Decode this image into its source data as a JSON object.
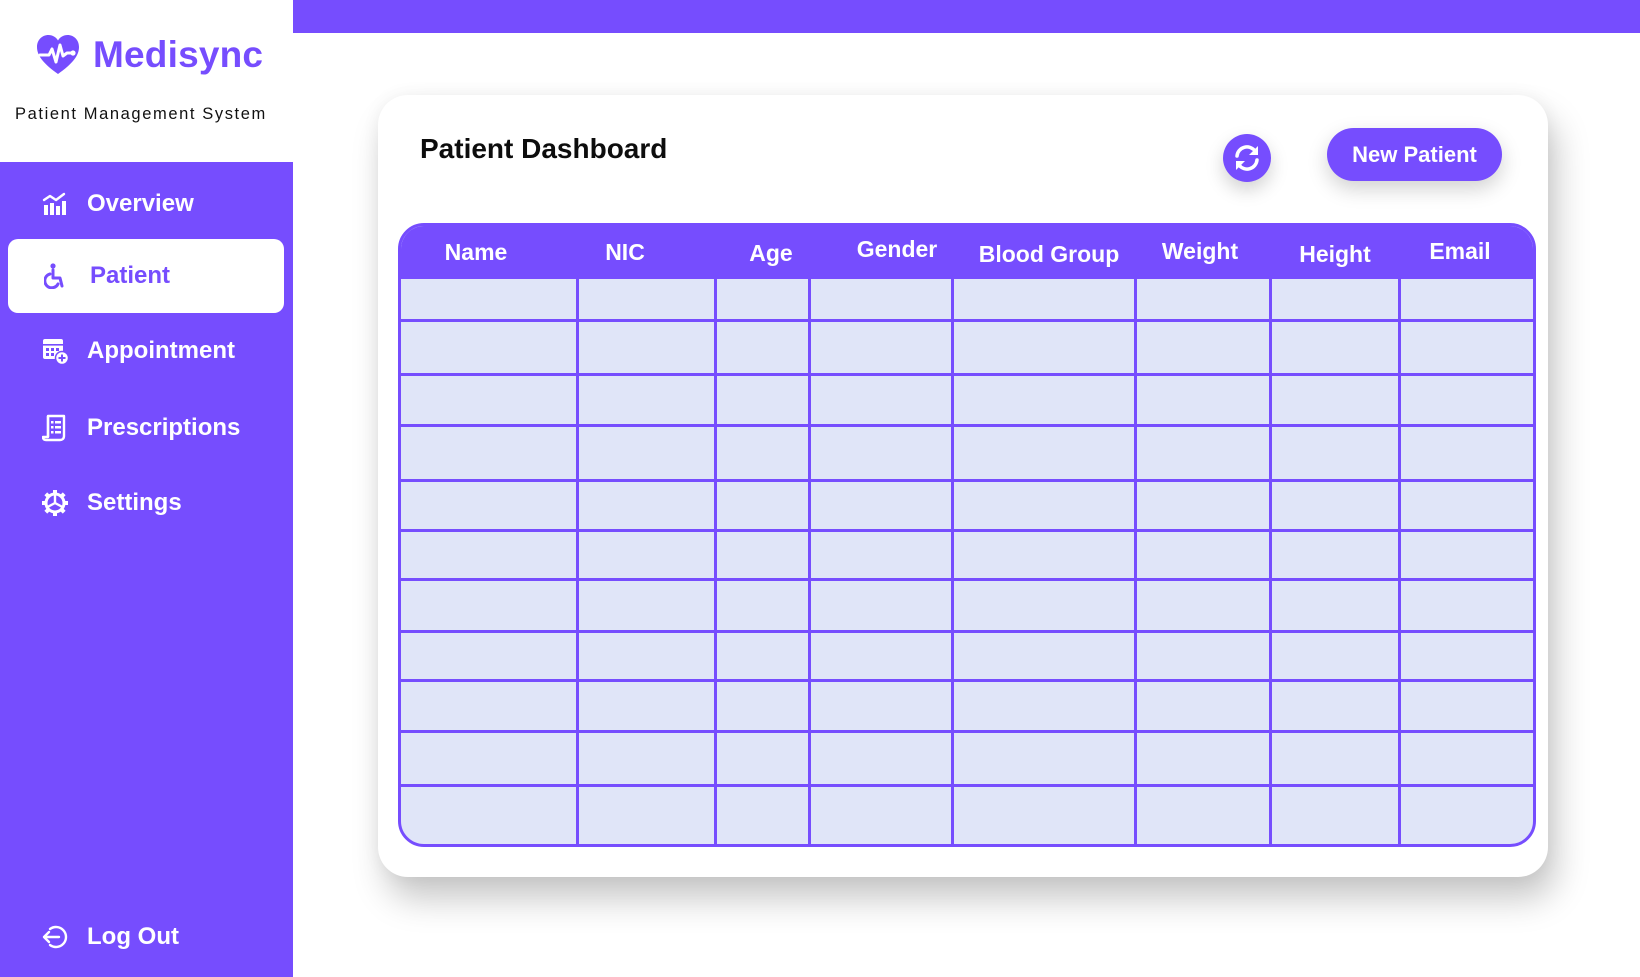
{
  "brand": {
    "name": "Medisync",
    "subtitle": "Patient Management System",
    "logo_icon": "heart-pulse-icon"
  },
  "colors": {
    "accent": "#764DFE",
    "table_cell_bg": "#E0E5F8",
    "text_dark": "#0D0D0D",
    "white": "#FFFFFF"
  },
  "sidebar": {
    "items": [
      {
        "label": "Overview",
        "icon": "chart-icon",
        "active": false
      },
      {
        "label": "Patient",
        "icon": "wheelchair-icon",
        "active": true
      },
      {
        "label": "Appointment",
        "icon": "calendar-add-icon",
        "active": false
      },
      {
        "label": "Prescriptions",
        "icon": "document-list-icon",
        "active": false
      },
      {
        "label": "Settings",
        "icon": "gear-icon",
        "active": false
      }
    ],
    "logout": {
      "label": "Log Out",
      "icon": "logout-icon"
    }
  },
  "main": {
    "title": "Patient Dashboard",
    "refresh_icon": "refresh-icon",
    "new_patient_label": "New Patient",
    "table": {
      "columns": [
        "Name",
        "NIC",
        "Age",
        "Gender",
        "Blood Group",
        "Weight",
        "Height",
        "Email"
      ],
      "rows": [
        [
          "",
          "",
          "",
          "",
          "",
          "",
          "",
          ""
        ],
        [
          "",
          "",
          "",
          "",
          "",
          "",
          "",
          ""
        ],
        [
          "",
          "",
          "",
          "",
          "",
          "",
          "",
          ""
        ],
        [
          "",
          "",
          "",
          "",
          "",
          "",
          "",
          ""
        ],
        [
          "",
          "",
          "",
          "",
          "",
          "",
          "",
          ""
        ],
        [
          "",
          "",
          "",
          "",
          "",
          "",
          "",
          ""
        ],
        [
          "",
          "",
          "",
          "",
          "",
          "",
          "",
          ""
        ],
        [
          "",
          "",
          "",
          "",
          "",
          "",
          "",
          ""
        ],
        [
          "",
          "",
          "",
          "",
          "",
          "",
          "",
          ""
        ],
        [
          "",
          "",
          "",
          "",
          "",
          "",
          "",
          ""
        ],
        [
          "",
          "",
          "",
          "",
          "",
          "",
          "",
          ""
        ]
      ]
    }
  }
}
